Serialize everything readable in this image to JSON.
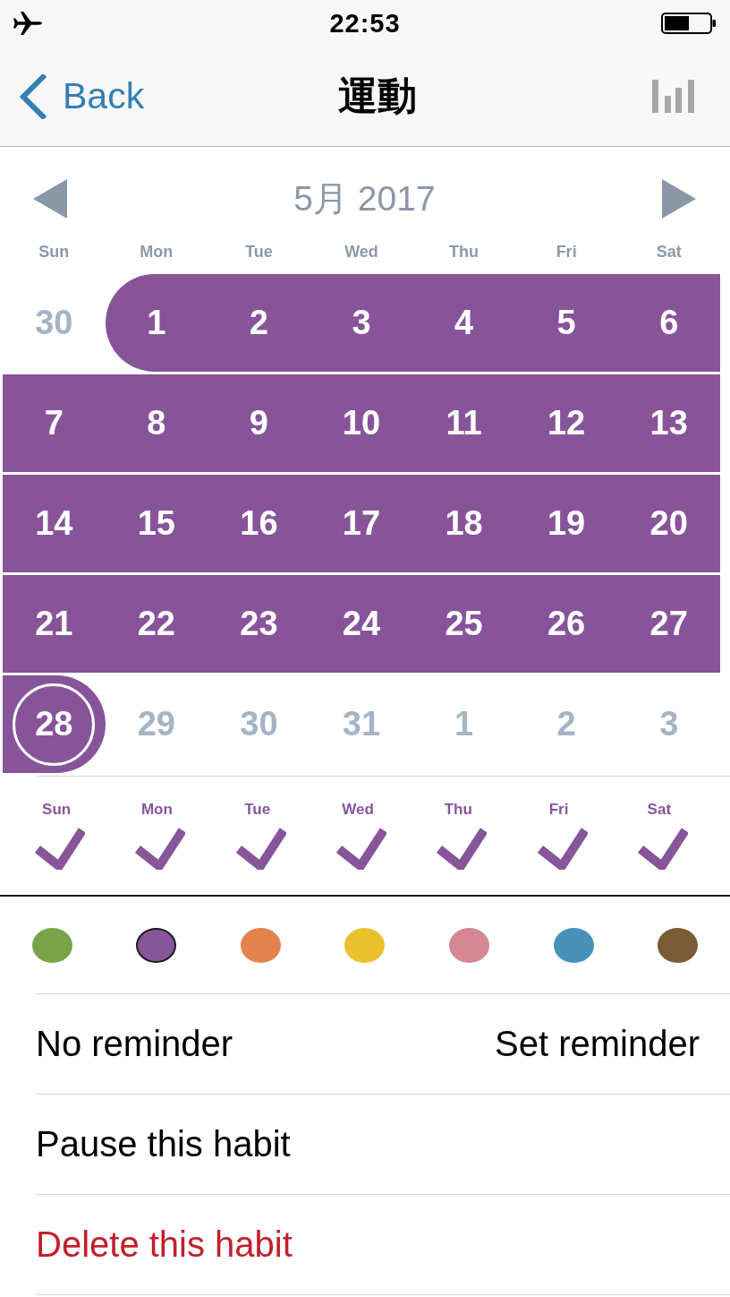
{
  "status_bar": {
    "time": "22:53"
  },
  "nav": {
    "back": "Back",
    "title": "運動"
  },
  "calendar": {
    "month": "5月 2017",
    "weekdays": [
      "Sun",
      "Mon",
      "Tue",
      "Wed",
      "Thu",
      "Fri",
      "Sat"
    ],
    "weeks": [
      [
        {
          "day": "30",
          "done": false,
          "today": false
        },
        {
          "day": "1",
          "done": true,
          "today": false
        },
        {
          "day": "2",
          "done": true,
          "today": false
        },
        {
          "day": "3",
          "done": true,
          "today": false
        },
        {
          "day": "4",
          "done": true,
          "today": false
        },
        {
          "day": "5",
          "done": true,
          "today": false
        },
        {
          "day": "6",
          "done": true,
          "today": false
        }
      ],
      [
        {
          "day": "7",
          "done": true,
          "today": false
        },
        {
          "day": "8",
          "done": true,
          "today": false
        },
        {
          "day": "9",
          "done": true,
          "today": false
        },
        {
          "day": "10",
          "done": true,
          "today": false
        },
        {
          "day": "11",
          "done": true,
          "today": false
        },
        {
          "day": "12",
          "done": true,
          "today": false
        },
        {
          "day": "13",
          "done": true,
          "today": false
        }
      ],
      [
        {
          "day": "14",
          "done": true,
          "today": false
        },
        {
          "day": "15",
          "done": true,
          "today": false
        },
        {
          "day": "16",
          "done": true,
          "today": false
        },
        {
          "day": "17",
          "done": true,
          "today": false
        },
        {
          "day": "18",
          "done": true,
          "today": false
        },
        {
          "day": "19",
          "done": true,
          "today": false
        },
        {
          "day": "20",
          "done": true,
          "today": false
        }
      ],
      [
        {
          "day": "21",
          "done": true,
          "today": false
        },
        {
          "day": "22",
          "done": true,
          "today": false
        },
        {
          "day": "23",
          "done": true,
          "today": false
        },
        {
          "day": "24",
          "done": true,
          "today": false
        },
        {
          "day": "25",
          "done": true,
          "today": false
        },
        {
          "day": "26",
          "done": true,
          "today": false
        },
        {
          "day": "27",
          "done": true,
          "today": false
        }
      ],
      [
        {
          "day": "28",
          "done": true,
          "today": true
        },
        {
          "day": "29",
          "done": false,
          "today": false
        },
        {
          "day": "30",
          "done": false,
          "today": false
        },
        {
          "day": "31",
          "done": false,
          "today": false
        },
        {
          "day": "1",
          "done": false,
          "today": false
        },
        {
          "day": "2",
          "done": false,
          "today": false
        },
        {
          "day": "3",
          "done": false,
          "today": false
        }
      ]
    ]
  },
  "schedule": [
    {
      "day": "Sun",
      "checked": true
    },
    {
      "day": "Mon",
      "checked": true
    },
    {
      "day": "Tue",
      "checked": true
    },
    {
      "day": "Wed",
      "checked": true
    },
    {
      "day": "Thu",
      "checked": true
    },
    {
      "day": "Fri",
      "checked": true
    },
    {
      "day": "Sat",
      "checked": true
    }
  ],
  "colors": [
    {
      "color": "#78a447",
      "selected": false
    },
    {
      "color": "#87559a",
      "selected": true
    },
    {
      "color": "#e5834f",
      "selected": false
    },
    {
      "color": "#e9c12e",
      "selected": false
    },
    {
      "color": "#d58794",
      "selected": false
    },
    {
      "color": "#4791b8",
      "selected": false
    },
    {
      "color": "#7b5b33",
      "selected": false
    }
  ],
  "reminder": {
    "label": "No reminder",
    "action": "Set reminder"
  },
  "actions": [
    {
      "label": "Pause this habit",
      "kind": "normal"
    },
    {
      "label": "Delete this habit",
      "kind": "destructive"
    }
  ]
}
